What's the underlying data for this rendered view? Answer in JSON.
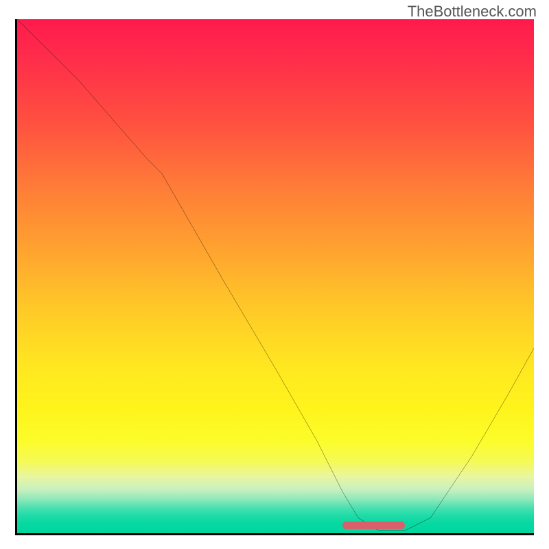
{
  "watermark": "TheBottleneck.com",
  "chart_data": {
    "type": "line",
    "title": "",
    "xlabel": "",
    "ylabel": "",
    "xlim": [
      0,
      100
    ],
    "ylim": [
      0,
      100
    ],
    "grid": false,
    "series": [
      {
        "name": "bottleneck-curve",
        "x": [
          0,
          12,
          25,
          28,
          40,
          50,
          58,
          63,
          66,
          70,
          75,
          80,
          88,
          95,
          100
        ],
        "values": [
          100,
          88,
          73,
          70,
          49,
          32,
          18,
          8,
          3,
          0.5,
          0.5,
          3,
          15,
          27,
          36
        ]
      }
    ],
    "marker": {
      "x_start": 63,
      "x_end": 75,
      "y": 0.8
    },
    "gradient_stops": [
      {
        "pos": 0,
        "color": "#ff1a4d"
      },
      {
        "pos": 50,
        "color": "#ffc020"
      },
      {
        "pos": 80,
        "color": "#fff020"
      },
      {
        "pos": 100,
        "color": "#00d69e"
      }
    ]
  }
}
